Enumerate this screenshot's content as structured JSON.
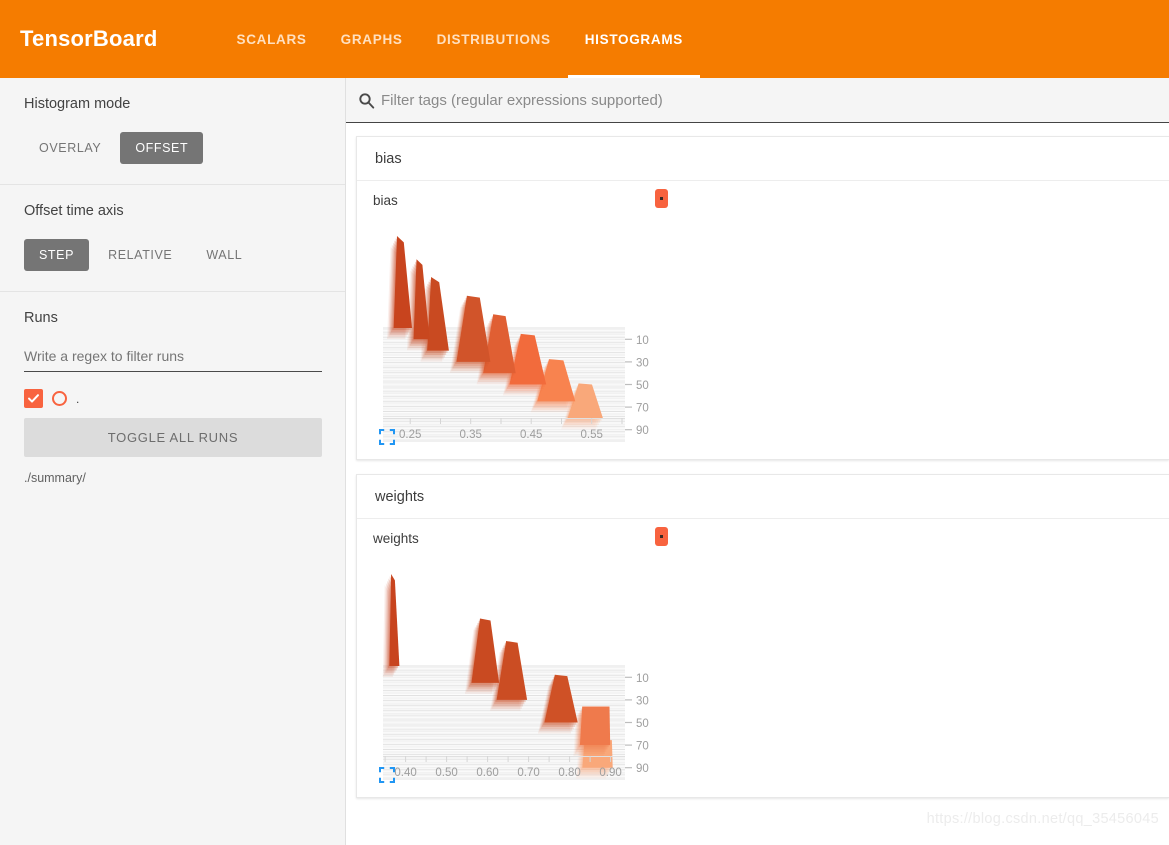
{
  "header": {
    "brand": "TensorBoard",
    "tabs": [
      {
        "label": "SCALARS",
        "active": false
      },
      {
        "label": "GRAPHS",
        "active": false
      },
      {
        "label": "DISTRIBUTIONS",
        "active": false
      },
      {
        "label": "HISTOGRAMS",
        "active": true
      }
    ],
    "accent_color": "#f57c00"
  },
  "sidebar": {
    "histogram_mode": {
      "title": "Histogram mode",
      "options": [
        "OVERLAY",
        "OFFSET"
      ],
      "selected": "OFFSET"
    },
    "offset_time_axis": {
      "title": "Offset time axis",
      "options": [
        "STEP",
        "RELATIVE",
        "WALL"
      ],
      "selected": "STEP"
    },
    "runs": {
      "title": "Runs",
      "filter_placeholder": "Write a regex to filter runs",
      "filter_value": "",
      "run_label": ".",
      "toggle_all_label": "TOGGLE ALL RUNS",
      "run_path": "./summary/",
      "run_color": "#f8633f"
    }
  },
  "search": {
    "placeholder": "Filter tags (regular expressions supported)",
    "value": "",
    "icon": "search-icon"
  },
  "cards": [
    {
      "header": "bias",
      "chart_key": "bias"
    },
    {
      "header": "weights",
      "chart_key": "weights"
    }
  ],
  "chart_data": [
    {
      "type": "area",
      "name": "bias",
      "title": "bias",
      "mode": "offset",
      "xlabel": "",
      "ylabel": "",
      "xlim": [
        0.205,
        0.605
      ],
      "xticks": [
        0.25,
        0.35,
        0.45,
        0.55
      ],
      "xtick_labels": [
        "0.25",
        "0.35",
        "0.45",
        "0.55"
      ],
      "yticks": [
        10,
        30,
        50,
        70,
        90
      ],
      "ytick_labels": [
        "10",
        "30",
        "50",
        "70",
        "90"
      ],
      "ylim": [
        0,
        100
      ],
      "series_name": ".",
      "colors": {
        "earliest": "#c8441e",
        "latest": "#f9a87a"
      },
      "ridges": [
        {
          "step": 0,
          "center": 0.237,
          "halfwidth": 0.016,
          "peak": 1.0,
          "color": "#c8441e",
          "shape": "spike"
        },
        {
          "step": 10,
          "center": 0.268,
          "halfwidth": 0.014,
          "peak": 0.87,
          "color": "#c8471f",
          "shape": "spike"
        },
        {
          "step": 20,
          "center": 0.295,
          "halfwidth": 0.019,
          "peak": 0.8,
          "color": "#c94a21",
          "shape": "spike"
        },
        {
          "step": 30,
          "center": 0.355,
          "halfwidth": 0.025,
          "peak": 0.72,
          "color": "#d1542a",
          "shape": "trapezoid"
        },
        {
          "step": 40,
          "center": 0.398,
          "halfwidth": 0.024,
          "peak": 0.64,
          "color": "#e05f33",
          "shape": "trapezoid"
        },
        {
          "step": 50,
          "center": 0.445,
          "halfwidth": 0.027,
          "peak": 0.55,
          "color": "#f26b3c",
          "shape": "trapezoid"
        },
        {
          "step": 65,
          "center": 0.492,
          "halfwidth": 0.028,
          "peak": 0.46,
          "color": "#f8834f",
          "shape": "trapezoid"
        },
        {
          "step": 80,
          "center": 0.54,
          "halfwidth": 0.026,
          "peak": 0.38,
          "color": "#f9a87a",
          "shape": "trapezoid"
        }
      ]
    },
    {
      "type": "area",
      "name": "weights",
      "title": "weights",
      "mode": "offset",
      "xlabel": "",
      "ylabel": "",
      "xlim": [
        0.345,
        0.935
      ],
      "xticks": [
        0.4,
        0.5,
        0.6,
        0.7,
        0.8,
        0.9
      ],
      "xtick_labels": [
        "0.40",
        "0.50",
        "0.60",
        "0.70",
        "0.80",
        "0.90"
      ],
      "yticks": [
        10,
        30,
        50,
        70,
        90
      ],
      "ytick_labels": [
        "10",
        "30",
        "50",
        "70",
        "90"
      ],
      "ylim": [
        0,
        100
      ],
      "series_name": ".",
      "colors": {
        "earliest": "#c8441e",
        "latest": "#f9a87a"
      },
      "ridges": [
        {
          "step": 0,
          "center": 0.372,
          "halfwidth": 0.013,
          "peak": 1.0,
          "color": "#c8441e",
          "shape": "spike"
        },
        {
          "step": 15,
          "center": 0.595,
          "halfwidth": 0.03,
          "peak": 0.7,
          "color": "#c94a21",
          "shape": "trapezoid"
        },
        {
          "step": 30,
          "center": 0.66,
          "halfwidth": 0.033,
          "peak": 0.64,
          "color": "#cb4d23",
          "shape": "trapezoid"
        },
        {
          "step": 50,
          "center": 0.78,
          "halfwidth": 0.036,
          "peak": 0.52,
          "color": "#cf5126",
          "shape": "trapezoid"
        },
        {
          "step": 70,
          "center": 0.862,
          "halfwidth": 0.037,
          "peak": 0.42,
          "color": "#ef7a4c",
          "shape": "block"
        },
        {
          "step": 90,
          "center": 0.868,
          "halfwidth": 0.037,
          "peak": 0.3,
          "color": "#f9a87a",
          "shape": "block"
        }
      ]
    }
  ],
  "icons": {
    "expand": "expand-icon",
    "expand_color": "#2196f3"
  },
  "watermark": "https://blog.csdn.net/qq_35456045"
}
